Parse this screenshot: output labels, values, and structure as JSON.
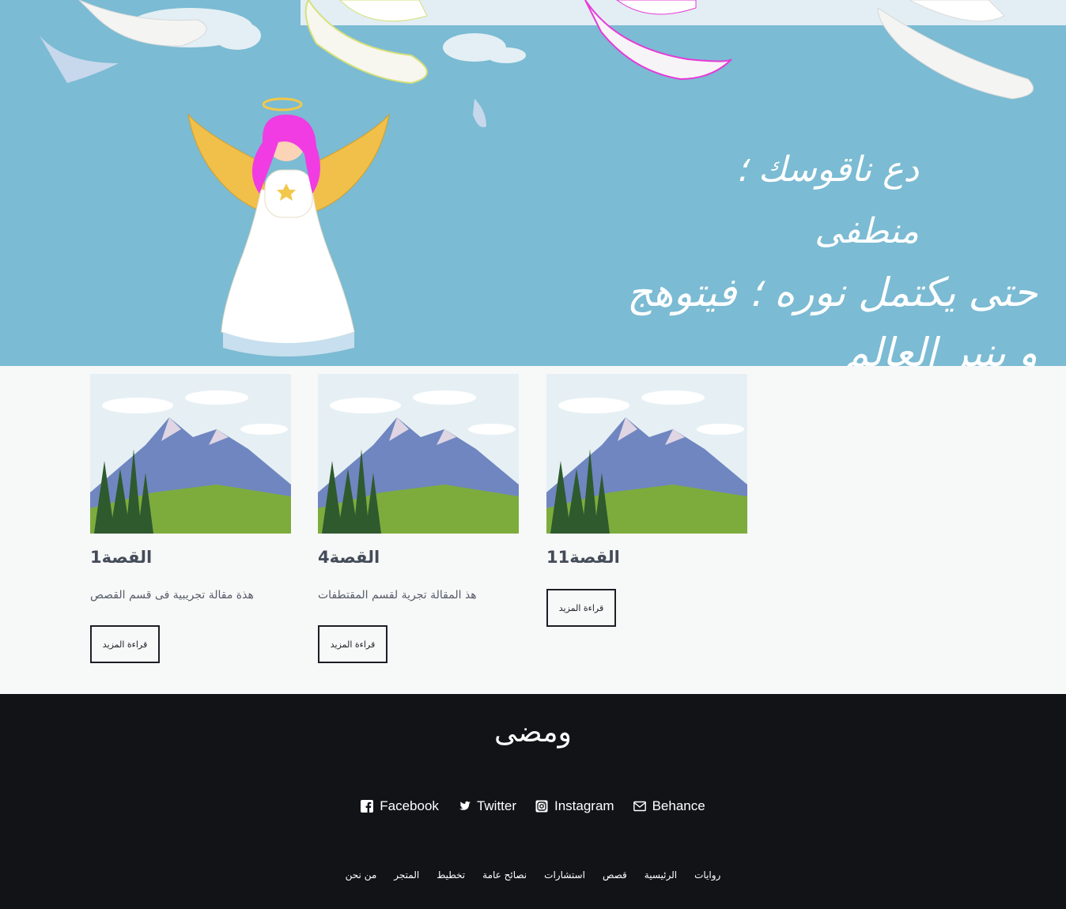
{
  "hero": {
    "line1": "دع ناقوسك ؛ منطفى",
    "line2": "حتى يكتمل نوره ؛ فيتوهج و ينير العالم"
  },
  "cards": [
    {
      "title": "القصة1",
      "excerpt": "هذة مقالة تجريبية فى قسم القصص",
      "button": "قراءة المزيد"
    },
    {
      "title": "القصة4",
      "excerpt": "هذ المقالة تجرية لقسم المقتطفات",
      "button": "قراءة المزيد"
    },
    {
      "title": "القصة11",
      "excerpt": "",
      "button": "قراءة المزيد"
    }
  ],
  "footer": {
    "title": "ومضى",
    "social": [
      {
        "label": "Facebook",
        "icon": "facebook-icon"
      },
      {
        "label": "Twitter",
        "icon": "twitter-icon"
      },
      {
        "label": "Instagram",
        "icon": "instagram-icon"
      },
      {
        "label": "Behance",
        "icon": "mail-icon"
      }
    ],
    "nav": [
      "روايات",
      "الرئيسية",
      "قصص",
      "استشارات",
      "نصائح عامة",
      "تخطيط",
      "المتجر",
      "من نحن"
    ]
  },
  "colors": {
    "hero_bg": "#7bbbd3",
    "footer_bg": "#121317",
    "page_bg": "#f7f8f8"
  }
}
